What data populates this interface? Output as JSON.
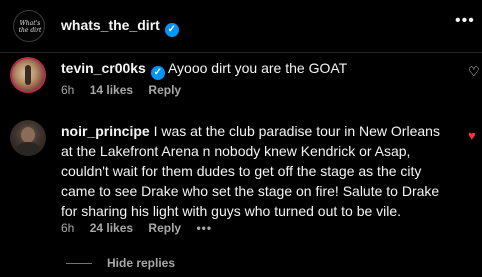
{
  "post": {
    "author": "whats_the_dirt",
    "avatar_text": "What's the dirt"
  },
  "comments": [
    {
      "username": "tevin_cr00ks",
      "verified": true,
      "text": "Ayooo dirt you are the GOAT",
      "time": "6h",
      "likes": "14 likes",
      "reply_label": "Reply",
      "liked": false
    },
    {
      "username": "noir_principe",
      "verified": false,
      "text": "I was at the club paradise tour in New Orleans at the Lakefront Arena n nobody knew Kendrick or Asap, couldn't wait for them dudes to get off the stage as the city came to see Drake who set the stage on fire! Salute to Drake for sharing his light with guys who turned out to be vile.",
      "time": "6h",
      "likes": "24 likes",
      "reply_label": "Reply",
      "liked": true
    }
  ],
  "replies_toggle_label": "Hide replies",
  "colors": {
    "background": "#000000",
    "text": "#f5f5f5",
    "muted": "#a8a8a8",
    "verified": "#0095f6",
    "like_active": "#ff3040"
  },
  "icons": [
    "verified-badge-icon",
    "more-options-icon",
    "heart-icon",
    "heart-filled-icon"
  ]
}
